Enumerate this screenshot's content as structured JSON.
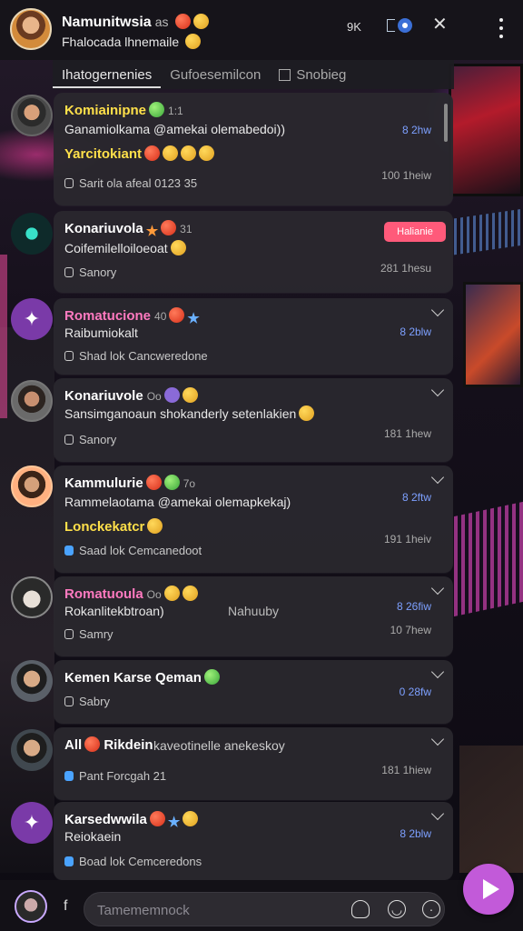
{
  "header": {
    "name": "Namunitwsia",
    "name_suffix": "as",
    "subtitle": "Fhalocada lhnemaile",
    "count": "9K"
  },
  "tabs": [
    {
      "label": "Ihatogernenies"
    },
    {
      "label": "Gufoesemilcon"
    },
    {
      "label": "Snobieg"
    }
  ],
  "posts": [
    {
      "name": "Komiainipne",
      "meta": "1:1",
      "line": "Ganamiolkama @amekai olemabedoi))",
      "highlight": "Yarcitokiant",
      "foot": "Sarit ola afeal 0123 35",
      "time": "8 2hw",
      "time2": "100 1heiw"
    },
    {
      "name": "Konariuvola",
      "meta": "31",
      "line": "Coifemilelloiloeoat",
      "foot": "Sanory",
      "time2": "281 1hesu",
      "badge": "Halianie"
    },
    {
      "name": "Romatucione",
      "meta": "40",
      "line": "Raibumiokalt",
      "foot": "Shad lok Cancweredone",
      "time": "8 2blw"
    },
    {
      "name": "Konariuvole",
      "meta": "Oo",
      "line": "Sansimganoaun shokanderly setenlakien",
      "foot": "Sanory",
      "time2": "181 1hew"
    },
    {
      "name": "Kammulurie",
      "meta": "7o",
      "line": "Rammelaotama @amekai olemapkekaj)",
      "highlight": "Lonckekatcr",
      "foot": "Saad lok Cemcanedoot",
      "time": "8 2ftw",
      "time2": "191 1heiv"
    },
    {
      "name": "Romatuoula",
      "meta": "Oo",
      "line": "Rokanlitekbtroan)",
      "mid": "Nahuuby",
      "foot": "Samry",
      "time": "8 26fiw",
      "time2": "10 7hew"
    },
    {
      "name": "Kemen Karse Qeman",
      "foot": "Sabry",
      "time": "0 28fw"
    },
    {
      "name": "All",
      "name2": "Rikdein",
      "line": "kaveotinelle anekeskoy",
      "foot": "Pant Forcgah 21",
      "time2": "181 1hiew"
    },
    {
      "name": "Karsedwwila",
      "line": "Reiokaein",
      "foot": "Boad lok Cemceredons",
      "time": "8 2blw"
    }
  ],
  "composer": {
    "f_label": "f",
    "placeholder": "Tamememnock"
  },
  "colors": {
    "accent": "#c25ad9",
    "time_blue": "#7da0ff",
    "badge": "#ff5a7a",
    "yellow_name": "#ffe04a",
    "pink_name": "#ff7ac0"
  }
}
